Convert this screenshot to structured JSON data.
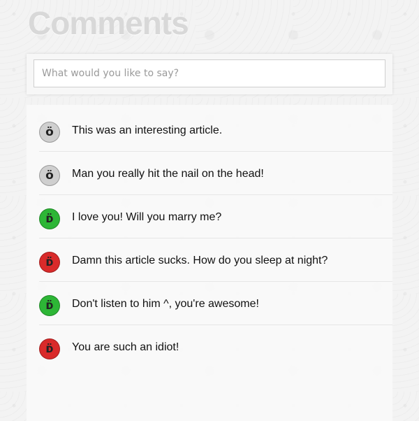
{
  "page": {
    "title": "Comments"
  },
  "input": {
    "placeholder": "What would you like to say?"
  },
  "comments": [
    {
      "text": "This was an interesting article.",
      "mood": "neutral",
      "face": "ö"
    },
    {
      "text": "Man you really hit the nail on the head!",
      "mood": "neutral",
      "face": "ö"
    },
    {
      "text": "I love you! Will you marry me?",
      "mood": "positive",
      "face": "ᴅ̈"
    },
    {
      "text": "Damn this article sucks. How do you sleep at night?",
      "mood": "negative",
      "face": "ᴅ̈"
    },
    {
      "text": "Don't listen to him ^, you're awesome!",
      "mood": "positive",
      "face": "ᴅ̈"
    },
    {
      "text": "You are such an idiot!",
      "mood": "negative",
      "face": "ᴅ̈"
    }
  ],
  "colors": {
    "neutral": "#cfcfcf",
    "positive": "#2db636",
    "negative": "#d92a2a"
  }
}
